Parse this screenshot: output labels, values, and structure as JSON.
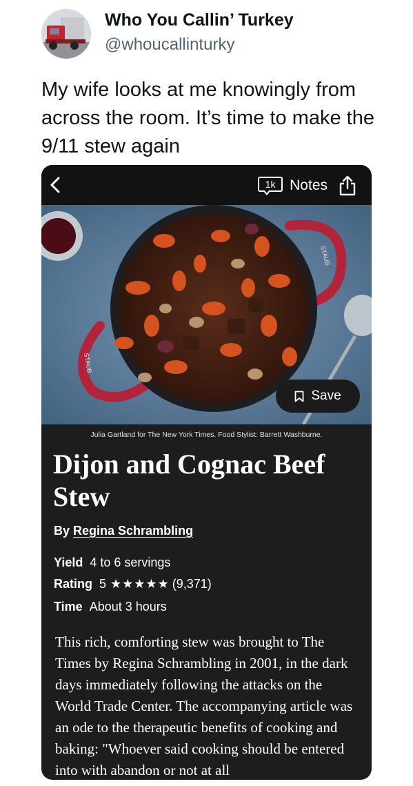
{
  "tweet": {
    "display_name": "Who You Callin’ Turkey",
    "handle": "@whoucallinturky",
    "text": "My wife looks at me knowingly from across the room. It’s time to make the 9/11 stew again"
  },
  "app": {
    "notes_count": "1k",
    "notes_label": "Notes",
    "save_label": "Save",
    "photo_credit": "Julia Gartland for The New York Times. Food Stylist: Barrett Washburne.",
    "recipe": {
      "title": "Dijon and Cognac Beef Stew",
      "by_prefix": "By",
      "author": "Regina Schrambling",
      "yield_label": "Yield",
      "yield_value": "4 to 6 servings",
      "rating_label": "Rating",
      "rating_value": "5",
      "rating_stars": "★★★★★",
      "rating_count": "(9,371)",
      "time_label": "Time",
      "time_value": "About 3 hours",
      "description": "This rich, comforting stew was brought to The Times by Regina Schrambling in 2001, in the dark days immediately following the attacks on the World Trade Center. The accompanying article was an ode to the therapeutic benefits of cooking and baking: \"Whoever said cooking should be entered into with abandon or not at all"
    },
    "pot_brand": "STAUB"
  },
  "colors": {
    "card_bg": "#1d1d1d",
    "topbar_bg": "#121212",
    "handle_gray": "#536471",
    "pot_red": "#b3233a"
  }
}
